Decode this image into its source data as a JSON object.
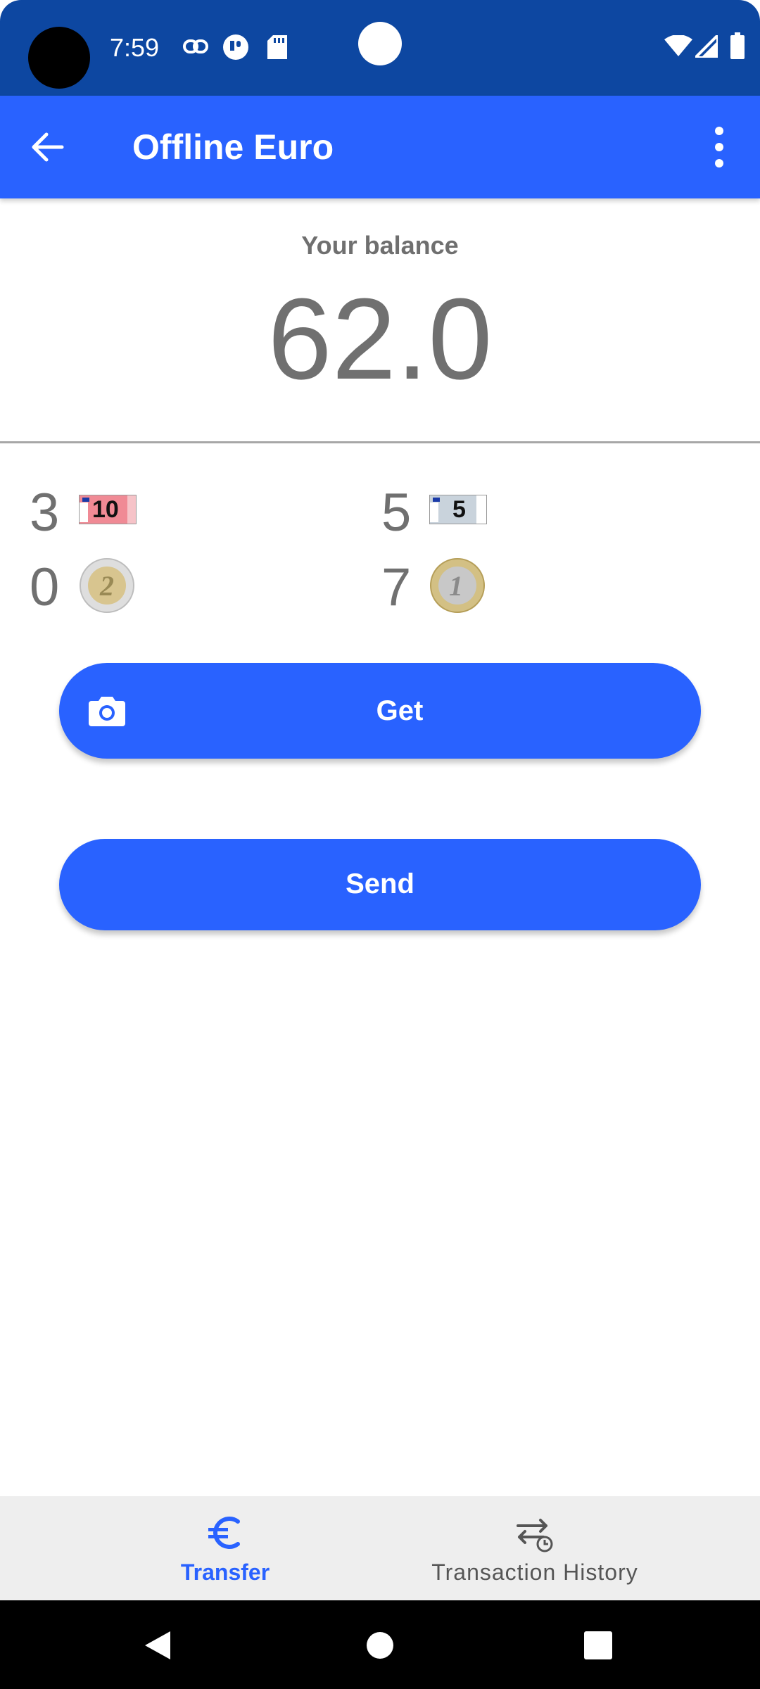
{
  "status_bar": {
    "time": "7:59",
    "icons": [
      "link-icon",
      "notification-icon",
      "sd-card-icon",
      "wifi-icon",
      "signal-icon",
      "battery-icon"
    ],
    "background": "#0d47a1"
  },
  "app_bar": {
    "title": "Offline Euro",
    "background": "#2962ff"
  },
  "balance": {
    "label": "Your balance",
    "value": "62.0"
  },
  "denominations": [
    {
      "count": "3",
      "item": "10 euro note"
    },
    {
      "count": "5",
      "item": "5 euro note"
    },
    {
      "count": "0",
      "item": "2 euro coin"
    },
    {
      "count": "7",
      "item": "1 euro coin"
    }
  ],
  "denomination_marks": {
    "note_10": "10",
    "note_5": "5",
    "coin_2": "2",
    "coin_1": "1"
  },
  "actions": {
    "get_label": "Get",
    "send_label": "Send"
  },
  "bottom_nav": {
    "tabs": [
      {
        "label": "Transfer",
        "icon": "euro-icon",
        "active": true
      },
      {
        "label": "Transaction History",
        "icon": "transaction-history-icon",
        "active": false
      }
    ],
    "active_color": "#2962ff",
    "inactive_color": "#555555"
  },
  "system_nav": {
    "icons": [
      "back-triangle-icon",
      "home-circle-icon",
      "recents-square-icon"
    ]
  }
}
